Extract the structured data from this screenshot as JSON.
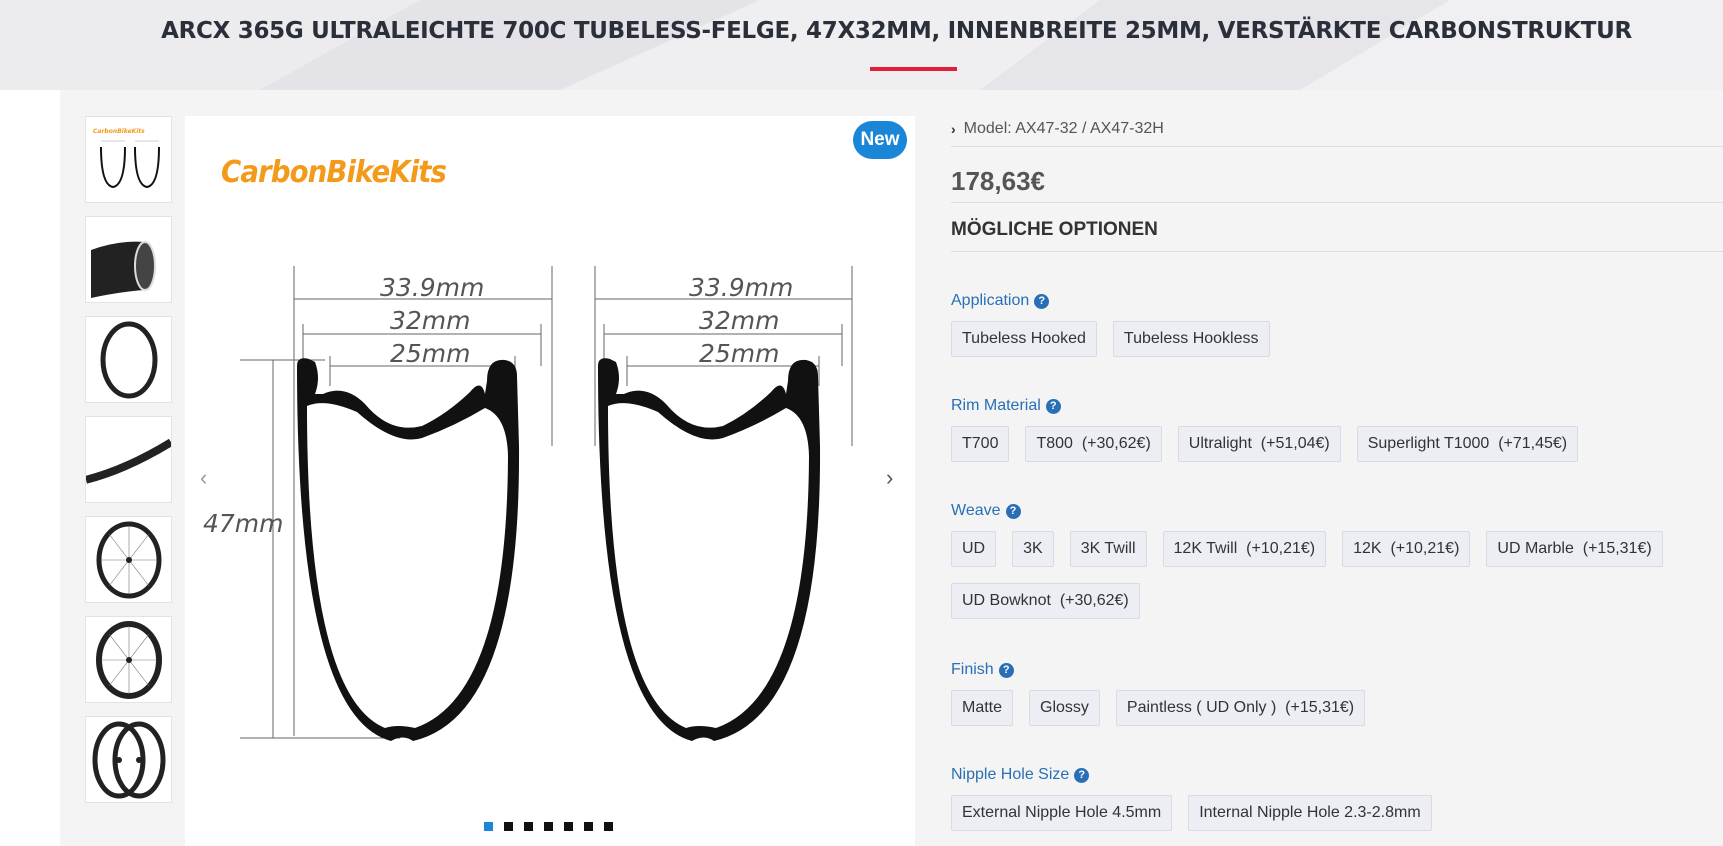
{
  "header": {
    "title": "ARCX 365G ULTRALEICHTE 700C TUBELESS-FELGE, 47X32MM, INNENBREITE 25MM, VERSTÄRKTE CARBONSTRUKTUR"
  },
  "gallery": {
    "badge": "New",
    "brand": "CarbonBikeKits",
    "thumbnail_count": 7,
    "active_index": 0,
    "diagram": {
      "outer_width": "33.9mm",
      "width_32": "32mm",
      "inner_width": "25mm",
      "height": "47mm"
    }
  },
  "product": {
    "model_label": "Model: AX47-32 / AX47-32H",
    "price": "178,63€",
    "options_title": "MÖGLICHE OPTIONEN",
    "groups": [
      {
        "label": "Application",
        "options": [
          "Tubeless Hooked",
          "Tubeless Hookless"
        ]
      },
      {
        "label": "Rim Material",
        "options": [
          "T700",
          "T800  (+30,62€)",
          "Ultralight  (+51,04€)",
          "Superlight T1000  (+71,45€)"
        ]
      },
      {
        "label": "Weave",
        "options": [
          "UD",
          "3K",
          "3K Twill",
          "12K Twill  (+10,21€)",
          "12K  (+10,21€)",
          "UD Marble  (+15,31€)",
          "UD Bowknot  (+30,62€)"
        ]
      },
      {
        "label": "Finish",
        "options": [
          "Matte",
          "Glossy",
          "Paintless ( UD Only )  (+15,31€)"
        ]
      },
      {
        "label": "Nipple Hole Size",
        "options": [
          "External Nipple Hole 4.5mm",
          "Internal Nipple Hole 2.3-2.8mm"
        ]
      }
    ]
  },
  "colors": {
    "accent_red": "#e0203a",
    "link_blue": "#2a6fb5",
    "badge_blue": "#1a86d8",
    "brand_orange": "#f39a1a"
  }
}
